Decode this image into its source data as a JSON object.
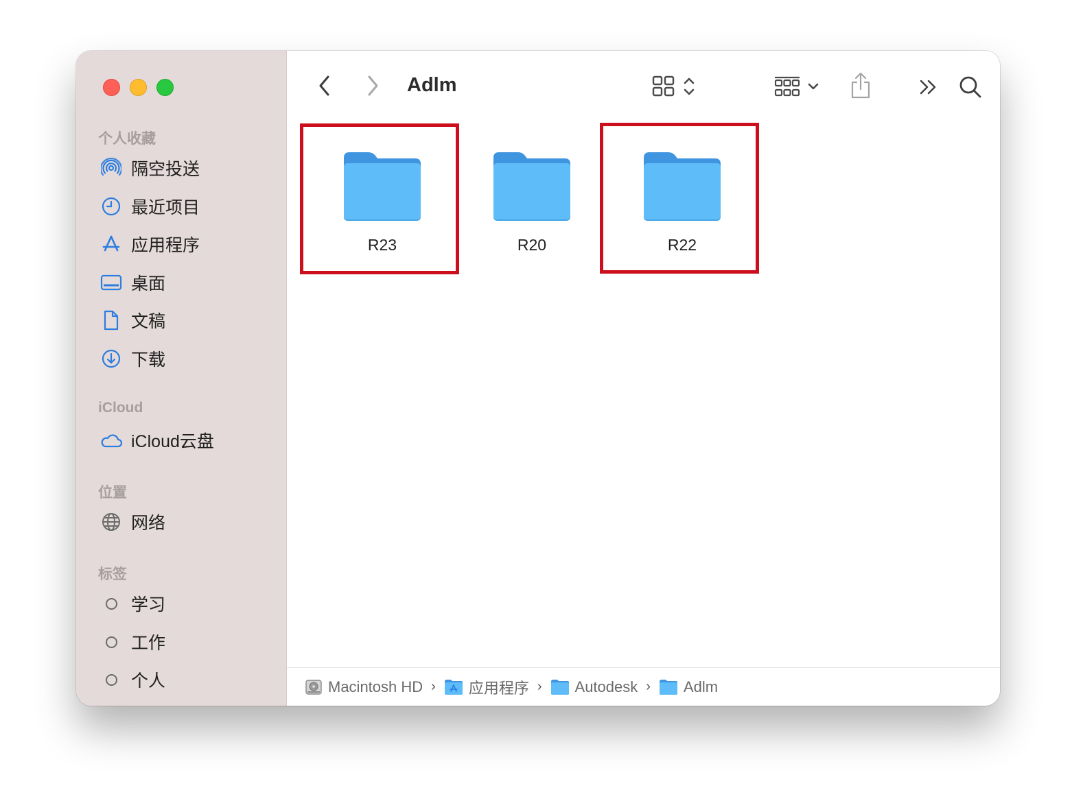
{
  "window": {
    "title": "Adlm"
  },
  "sidebar": {
    "favorites_header": "个人收藏",
    "favorites": [
      {
        "label": "隔空投送",
        "icon": "airdrop-icon"
      },
      {
        "label": "最近项目",
        "icon": "clock-icon"
      },
      {
        "label": "应用程序",
        "icon": "applications-icon"
      },
      {
        "label": "桌面",
        "icon": "desktop-icon"
      },
      {
        "label": "文稿",
        "icon": "document-icon"
      },
      {
        "label": "下载",
        "icon": "download-icon"
      }
    ],
    "icloud_header": "iCloud",
    "icloud": [
      {
        "label": "iCloud云盘",
        "icon": "cloud-icon"
      }
    ],
    "locations_header": "位置",
    "locations": [
      {
        "label": "网络",
        "icon": "globe-icon"
      }
    ],
    "tags_header": "标签",
    "tags": [
      {
        "label": "学习"
      },
      {
        "label": "工作"
      },
      {
        "label": "个人"
      }
    ]
  },
  "folders": [
    {
      "name": "R23",
      "highlighted": true
    },
    {
      "name": "R20",
      "highlighted": false
    },
    {
      "name": "R22",
      "highlighted": true
    }
  ],
  "pathbar": [
    {
      "label": "Macintosh HD",
      "icon": "hard-drive-icon"
    },
    {
      "label": "应用程序",
      "icon": "applications-folder-icon"
    },
    {
      "label": "Autodesk",
      "icon": "folder-icon"
    },
    {
      "label": "Adlm",
      "icon": "folder-icon"
    }
  ],
  "colors": {
    "sidebar_bg": "#e5dada",
    "accent": "#2b7de0",
    "folder": "#5ebcf8",
    "highlight_box": "#cc0f1c"
  }
}
